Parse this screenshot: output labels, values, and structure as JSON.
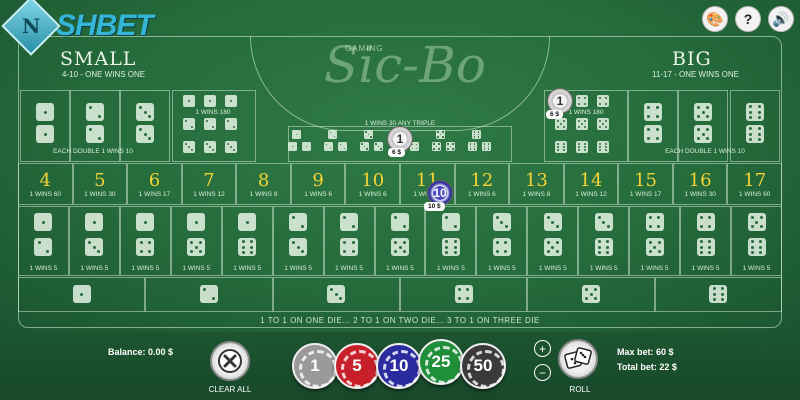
{
  "brand": {
    "logo_letter": "N",
    "logo_text": "SHBET"
  },
  "top_icons": [
    "palette-icon",
    "help-icon",
    "sound-icon"
  ],
  "top_icon_glyphs": {
    "palette": "🎨",
    "help": "?",
    "sound": "🔊"
  },
  "header": {
    "game_title": "Sic-Bo",
    "gaming_label": "GAMING",
    "small": {
      "title": "SMALL",
      "subtitle": "4-10 - ONE WINS ONE"
    },
    "big": {
      "title": "BIG",
      "subtitle": "11-17 - ONE WINS ONE"
    }
  },
  "doubles": {
    "left_label": "EACH DOUBLE 1 WINS 10",
    "right_label": "EACH DOUBLE 1 WINS 10"
  },
  "triples": {
    "left_label": "1 WINS 180",
    "right_label": "1 WINS 180",
    "any_triple_label": "1 WINS 30 ANY TRIPLE"
  },
  "totals": [
    {
      "num": "4",
      "odds": "1 WINS 60"
    },
    {
      "num": "5",
      "odds": "1 WINS 30"
    },
    {
      "num": "6",
      "odds": "1 WINS 17"
    },
    {
      "num": "7",
      "odds": "1 WINS 12"
    },
    {
      "num": "8",
      "odds": "1 WINS 8"
    },
    {
      "num": "9",
      "odds": "1 WINS 6"
    },
    {
      "num": "10",
      "odds": "1 WINS 6"
    },
    {
      "num": "11",
      "odds": "1 WINS 6"
    },
    {
      "num": "12",
      "odds": "1 WINS 6"
    },
    {
      "num": "13",
      "odds": "1 WINS 8"
    },
    {
      "num": "14",
      "odds": "1 WINS 12"
    },
    {
      "num": "15",
      "odds": "1 WINS 17"
    },
    {
      "num": "16",
      "odds": "1 WINS 30"
    },
    {
      "num": "17",
      "odds": "1 WINS 60"
    }
  ],
  "combo_odds": "1 WINS 5",
  "placed_chips": [
    {
      "value": "1",
      "tag": "6 $"
    },
    {
      "value": "1",
      "tag": "6 $"
    },
    {
      "value": "10",
      "tag": "10 $"
    }
  ],
  "rule_text": "1 TO 1 ON ONE DIE... 2 TO 1 ON TWO DIE... 3 TO 1 ON THREE DIE",
  "bottom": {
    "balance": "Balance: 0.00 $",
    "clear_all": "CLEAR ALL",
    "roll": "ROLL",
    "max_bet": "Max bet: 60 $",
    "total_bet": "Total bet: 22 $",
    "plus": "+",
    "minus": "−",
    "chips": [
      {
        "value": "1",
        "color": "#9a9a9a"
      },
      {
        "value": "5",
        "color": "#c8202a"
      },
      {
        "value": "10",
        "color": "#2b2ba0"
      },
      {
        "value": "25",
        "color": "#1f8f3a"
      },
      {
        "value": "50",
        "color": "#3a3a3a"
      }
    ]
  }
}
